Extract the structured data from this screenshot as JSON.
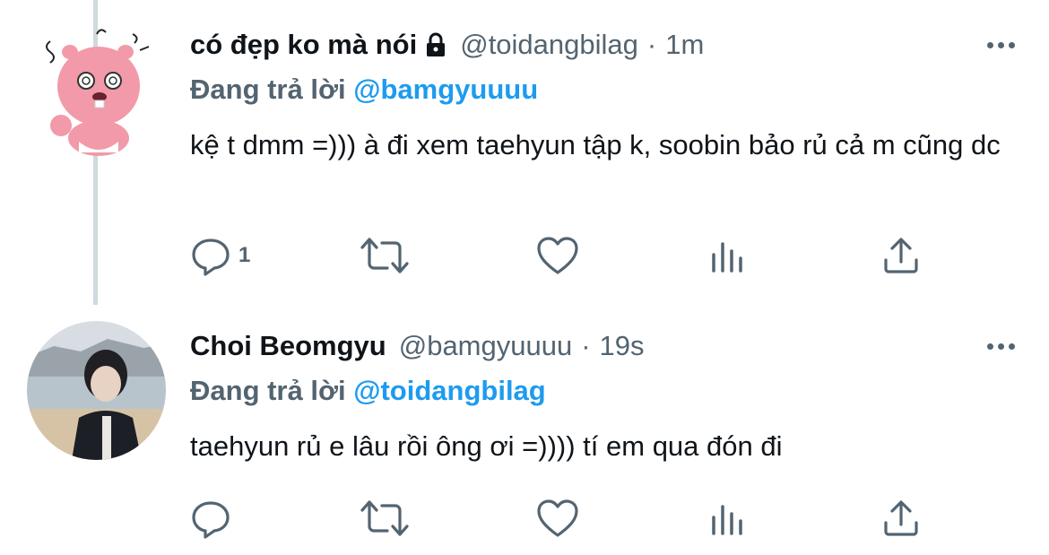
{
  "tweets": [
    {
      "name": "có đẹp ko mà nói",
      "handle": "@toidangbilag",
      "separator": "·",
      "time": "1m",
      "reply_prefix": "Đang trả lời",
      "reply_to": "@bamgyuuuu",
      "text": "kệ t dmm =))) à đi xem taehyun tập k, soobin bảo rủ cả m cũng dc",
      "reply_count": "1",
      "locked": true,
      "avatar_icon": "pink-beaver-avatar"
    },
    {
      "name": "Choi Beomgyu",
      "handle": "@bamgyuuuu",
      "separator": "·",
      "time": "19s",
      "reply_prefix": "Đang trả lời",
      "reply_to": "@toidangbilag",
      "text": "taehyun rủ e lâu rồi ông ơi =)))) tí em qua đón đi",
      "reply_count": "",
      "locked": false,
      "avatar_icon": "beach-photo-avatar"
    }
  ],
  "colors": {
    "accent": "#1d9bf0",
    "secondary": "#536471",
    "thread_line": "#cfd9de",
    "primary_text": "#0f1419"
  },
  "action_icons": [
    "reply-icon",
    "retweet-icon",
    "like-icon",
    "views-icon",
    "share-icon"
  ]
}
